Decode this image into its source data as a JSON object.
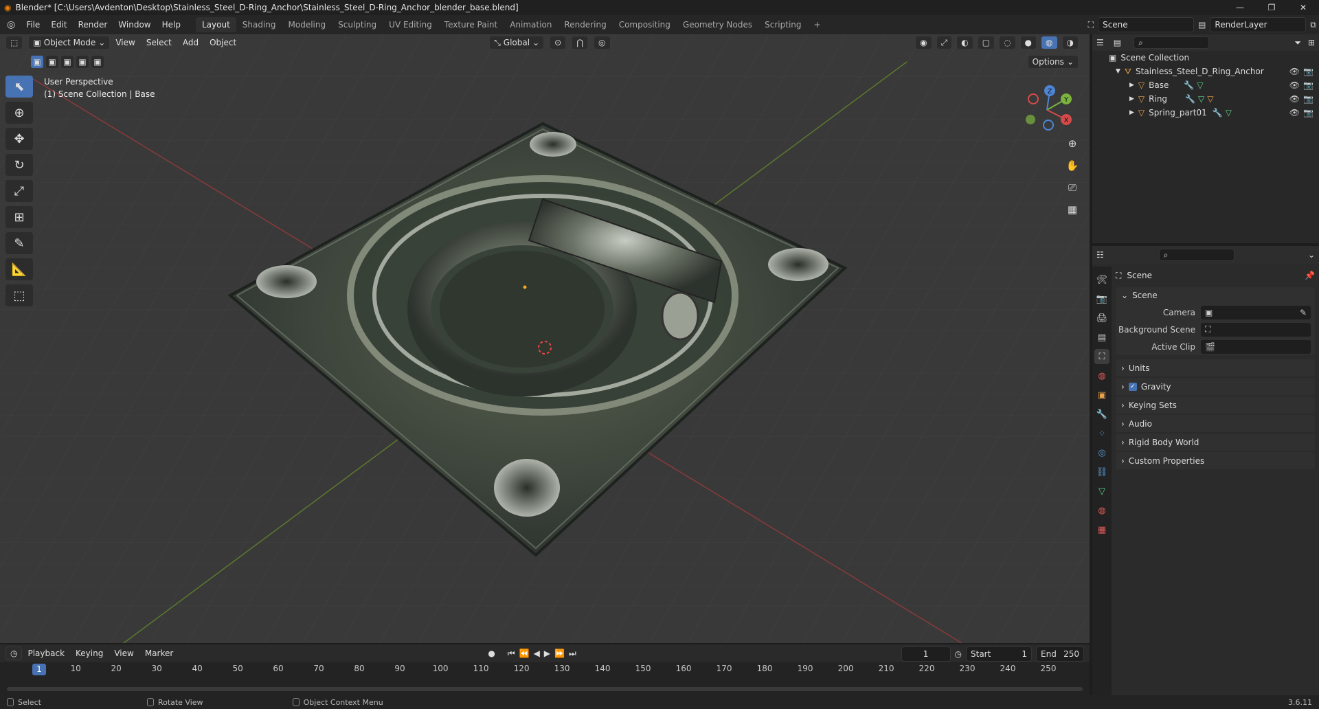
{
  "window": {
    "title": "Blender* [C:\\Users\\Avdenton\\Desktop\\Stainless_Steel_D-Ring_Anchor\\Stainless_Steel_D-Ring_Anchor_blender_base.blend]",
    "controls": [
      "—",
      "❐",
      "✕"
    ]
  },
  "menus": [
    "File",
    "Edit",
    "Render",
    "Window",
    "Help"
  ],
  "workspaces": [
    {
      "label": "Layout",
      "active": true
    },
    {
      "label": "Shading"
    },
    {
      "label": "Modeling"
    },
    {
      "label": "Sculpting"
    },
    {
      "label": "UV Editing"
    },
    {
      "label": "Texture Paint"
    },
    {
      "label": "Animation"
    },
    {
      "label": "Rendering"
    },
    {
      "label": "Compositing"
    },
    {
      "label": "Geometry Nodes"
    },
    {
      "label": "Scripting"
    }
  ],
  "add_workspace": "+",
  "scene_selector": {
    "value": "Scene"
  },
  "view_layer": {
    "value": "RenderLayer"
  },
  "viewport": {
    "mode": "Object Mode",
    "menus": [
      "View",
      "Select",
      "Add",
      "Object"
    ],
    "transform_orientation": "Global",
    "options_label": "Options",
    "info_line1": "User Perspective",
    "info_line2": "(1) Scene Collection | Base",
    "gizmo": {
      "z": "Z",
      "y": "Y",
      "x": "X"
    }
  },
  "outliner": {
    "root": "Scene Collection",
    "items": [
      {
        "label": "Stainless_Steel_D_Ring_Anchor",
        "depth": 1
      },
      {
        "label": "Base",
        "depth": 2
      },
      {
        "label": "Ring",
        "depth": 2
      },
      {
        "label": "Spring_part01",
        "depth": 2
      }
    ]
  },
  "properties": {
    "context_title": "Scene",
    "panel_title": "Scene",
    "rows": [
      {
        "label": "Camera",
        "value": ""
      },
      {
        "label": "Background Scene",
        "value": ""
      },
      {
        "label": "Active Clip",
        "value": ""
      }
    ],
    "subpanels": [
      "Units",
      "Gravity",
      "Keying Sets",
      "Audio",
      "Rigid Body World",
      "Custom Properties"
    ]
  },
  "timeline": {
    "menus": [
      "Playback",
      "Keying",
      "View",
      "Marker"
    ],
    "current_frame": "1",
    "start_label": "Start",
    "start_value": "1",
    "end_label": "End",
    "end_value": "250",
    "ticks": [
      "10",
      "20",
      "30",
      "40",
      "50",
      "60",
      "70",
      "80",
      "90",
      "100",
      "110",
      "120",
      "130",
      "140",
      "150",
      "160",
      "170",
      "180",
      "190",
      "200",
      "210",
      "220",
      "230",
      "240",
      "250"
    ],
    "cursor": "1"
  },
  "statusbar": {
    "select": "Select",
    "rotate": "Rotate View",
    "context_menu": "Object Context Menu",
    "version": "3.6.11"
  }
}
